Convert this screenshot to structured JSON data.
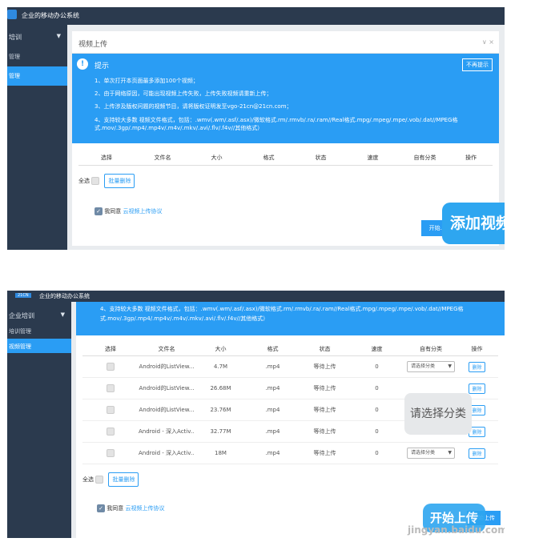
{
  "app_title": "企业的移动办公系统",
  "s1": {
    "sidebar": {
      "group": "培训",
      "items": [
        "管理",
        "管理"
      ]
    },
    "dialog_title": "视频上传",
    "dialog_controls": "∨ ×",
    "notice": {
      "title": "提示",
      "dismiss": "不再提示",
      "lines": [
        "1、单次打开本页面最多添加100个视频；",
        "2、由于网络原因，可能出现视频上传失败，上传失败视频请重新上传；",
        "3、上传涉及版权问题的视频节目，请将版权证明发至vgo-21cn@21cn.com；",
        "4、支持较大多数 视频文件格式，包括：.wmv(.wm/.asf/.asx)/微软格式.rm/.rmvb/.ra/.ram//Real格式.mpg/.mpeg/.mpe/.vob/.dat//MPEG格式.mov/.3gp/.mp4/.mp4v/.m4v/.mkv/.avi/.flv/.f4v//其他格式）"
      ]
    },
    "columns": [
      "选择",
      "文件名",
      "大小",
      "格式",
      "状态",
      "速度",
      "自有分类",
      "操作"
    ],
    "select_all": "全选",
    "batch_delete": "批量删除",
    "agree_text": "我同意",
    "agree_link": "云视频上传协议",
    "start_btn": "开始...",
    "callout": "添加视频"
  },
  "s2": {
    "app_tag": "21CN",
    "sidebar": {
      "group": "企业培训",
      "items": [
        "培训管理",
        "视频管理"
      ]
    },
    "notice_lines": [
      "4、支持较大多数 视频文件格式，包括：.wmv(.wm/.asf/.asx)/微软格式.rm/.rmvb/.ra/.ram//Real格式.mpg/.mpeg/.mpe/.vob/.dat//MPEG格",
      "式.mov/.3gp/.mp4/.mp4v/.m4v/.mkv/.avi/.flv/.f4v//其他格式）"
    ],
    "columns": [
      "选择",
      "文件名",
      "大小",
      "格式",
      "状态",
      "速度",
      "自有分类",
      "操作"
    ],
    "rows": [
      {
        "name": "Android的ListView...",
        "size": "4.7M",
        "fmt": ".mp4",
        "status": "等待上传",
        "speed": "0",
        "cat": "请选择分类",
        "op": "删除"
      },
      {
        "name": "Android的ListView...",
        "size": "26.68M",
        "fmt": ".mp4",
        "status": "等待上传",
        "speed": "0",
        "cat": "",
        "op": "删除"
      },
      {
        "name": "Android的ListView...",
        "size": "23.76M",
        "fmt": ".mp4",
        "status": "等待上传",
        "speed": "0",
        "cat": "",
        "op": "删除"
      },
      {
        "name": "Android - 深入Activ...",
        "size": "32.77M",
        "fmt": ".mp4",
        "status": "等待上传",
        "speed": "0",
        "cat": "",
        "op": "删除"
      },
      {
        "name": "Android - 深入Activ...",
        "size": "18M",
        "fmt": ".mp4",
        "status": "等待上传",
        "speed": "0",
        "cat": "请选择分类",
        "op": "删除"
      }
    ],
    "select_all": "全选",
    "batch_delete": "批量删除",
    "agree_text": "我同意",
    "agree_link": "云视频上传协议",
    "start_btn": "开始上传",
    "callout_category": "请选择分类",
    "callout_start": "开始上传",
    "watermark": "jingyan.baidu.com"
  }
}
